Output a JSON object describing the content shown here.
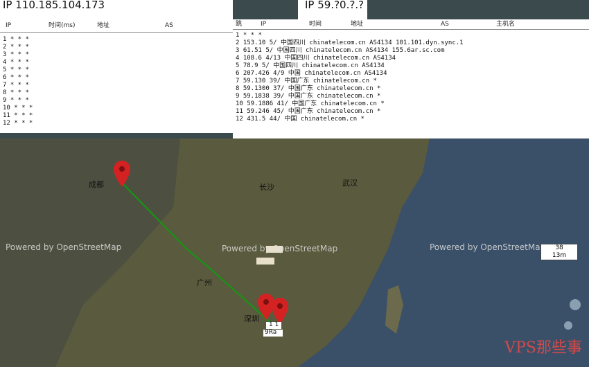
{
  "left_panel": {
    "title": "IP 110.185.104.173",
    "headers": [
      "IP",
      "时间(ms)",
      "地址",
      "AS"
    ],
    "rows": [
      "1  *      *   *",
      "2  *      *   *",
      "3  *      *   *",
      "4  *      *   *",
      "5  *      *   *",
      "6  *      *   *",
      "7  *      *   *",
      "8  *      *   *",
      "9  *      *   *",
      "10 *      *   *",
      "11 *      *   *",
      "12 *      *   *"
    ]
  },
  "right_panel": {
    "title": "IP 59.?0.?.?",
    "headers": [
      "跳",
      "IP",
      "时间",
      "地址",
      "AS",
      "主机名"
    ],
    "rows": [
      "1 *        *   *",
      "2 153.10   5/  中国四川 chinatelecom.cn  AS4134  101.101.dyn.sync.1",
      "3 61.51     5/  中国四川 chinatelecom.cn  AS4134  155.6ar.sc.com",
      "4 108.6     4/13 中国四川 chinatelecom.cn AS4134",
      "5 78.9      5/  中国四川 chinatelecom.cn  AS4134",
      "6 207.426   4/9  中国 chinatelecom.cn     AS4134",
      "7 59.130    39/  中国广东 chinatelecom.cn *",
      "8 59.1300   37/  中国广东 chinatelecom.cn *",
      "9 59.1838   39/  中国广东 chinatelecom.cn *",
      "10 59.1886  41/  中国广东 chinatelecom.cn *",
      "11 59.246   45/  中国广东 chinatelecom.cn *",
      "12 431.5    44/  中国 chinatelecom.cn     *"
    ]
  },
  "map": {
    "labels": [
      "成都",
      "武汉",
      "长沙",
      "广州",
      "深圳"
    ],
    "scale_top": "38",
    "scale_bottom": "13m",
    "route_color": "#119911",
    "pin_color": "#d42222",
    "hk_label": "1 1",
    "hk_sublabel": "9Ra"
  },
  "watermark": "VPS那些事",
  "credits": [
    "Powered by OpenStreetMap",
    "Powered by OpenStreetMap",
    "Powered by OpenStreetMap"
  ]
}
